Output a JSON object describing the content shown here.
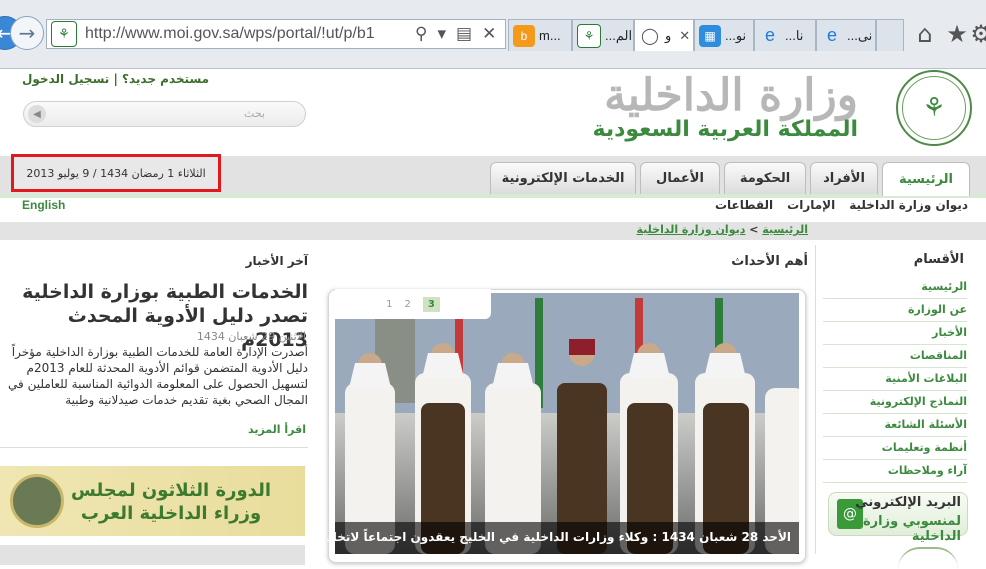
{
  "browser": {
    "url": "http://www.moi.gov.sa/wps/portal/!ut/p/b1",
    "tabs": [
      {
        "label": "m..."
      },
      {
        "label": "...الم"
      },
      {
        "label": "و"
      },
      {
        "label": "...نو"
      },
      {
        "label": "...نا"
      },
      {
        "label": "...نى"
      }
    ]
  },
  "header": {
    "login_text": "مستخدم جديد؟ | تسجيل الدخول",
    "search_placeholder": "بحث",
    "ministry_name": "وزارة الداخلية",
    "kingdom_name": "المملكة العربية السعودية",
    "date": "الثلاثاء 1 رمضان 1434 / 9 يوليو 2013"
  },
  "menu": {
    "tabs": [
      "الرئيسية",
      "الأفراد",
      "الحكومة",
      "الأعمال",
      "الخدمات الإلكترونية"
    ],
    "active": 0,
    "submenu": [
      "ديوان وزارة الداخلية",
      "الإمارات",
      "القطاعات"
    ],
    "english_link": "English"
  },
  "breadcrumb": {
    "home": "الرئيسية",
    "separator": ">",
    "current": "ديوان وزارة الداخلية"
  },
  "sidebar": {
    "title": "الأقسام",
    "items": [
      "الرئيسية",
      "عن الوزارة",
      "الأخبار",
      "المناقصات",
      "البلاغات الأمنية",
      "النماذج الإلكترونية",
      "الأسئلة الشائعة",
      "أنظمة وتعليمات",
      "آراء وملاحظات"
    ],
    "mail_line1": "البريد الإلكتروني",
    "mail_line2": "لمنسوبي وزارة الداخلية"
  },
  "events": {
    "title": "أهم الأحداث",
    "pager": [
      "1",
      "2",
      "3"
    ],
    "active_page": 2,
    "caption": "الأحد 28 شعبان 1434 : وكلاء وزارات الداخلية في الخليج يعقدون اجتماعاً لاتخاذ إجراءات ضد"
  },
  "news": {
    "title": "آخر الأخبار",
    "headline": "الخدمات الطبية بوزارة الداخلية تصدر دليل الأدوية المحدث 2013م",
    "date": "الاثنين 29 شعبان 1434",
    "body": "أصدرت الإدارة العامة للخدمات الطبية بوزارة الداخلية مؤخراً دليل الأدوية المتضمن قوائم الأدوية المحدثة للعام 2013م لتسهيل الحصول على المعلومة الدوائية المناسبة للعاملين في المجال الصحي بغية تقديم خدمات صيدلانية وطبية",
    "more": "اقرأ المزيد",
    "banner_line1": "الدورة الثلاثون لمجلس",
    "banner_line2": "وزراء الداخلية العرب"
  },
  "colors": {
    "brand_green": "#3b8a3e",
    "date_highlight": "#e0191f",
    "logo_gray": "#b7b7b7"
  }
}
